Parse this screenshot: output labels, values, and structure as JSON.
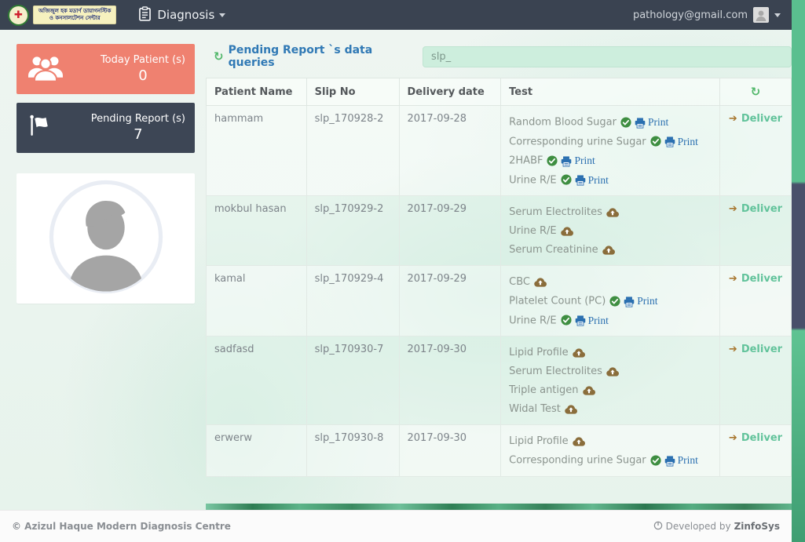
{
  "navbar": {
    "logo_glyph": "✚",
    "brand_line1": "অজিজুল হক মডার্ণ ডায়াগনস্টিক",
    "brand_line2": "ও কনসালটেশন সেন্টার",
    "menu_label": "Diagnosis",
    "user_email": "pathology@gmail.com"
  },
  "sidebar": {
    "cards": [
      {
        "icon": "users",
        "label": "Today Patient (s)",
        "value": "0",
        "bg": "#ef8170"
      },
      {
        "icon": "flag",
        "label": "Pending Report (s)",
        "value": "7",
        "bg": "#3d4655"
      }
    ]
  },
  "main": {
    "title": "Pending Report `s data queries",
    "search_value": "slp_",
    "table": {
      "headers": [
        "Patient Name",
        "Slip No",
        "Delivery date",
        "Test"
      ],
      "print_label": "Print",
      "deliver_label": "Deliver",
      "rows": [
        {
          "patient": "hammam",
          "slip": "slp_170928-2",
          "date": "2017-09-28",
          "tests": [
            {
              "name": "Random Blood Sugar",
              "printable": true
            },
            {
              "name": "Corresponding urine Sugar",
              "printable": true
            },
            {
              "name": "2HABF",
              "printable": true
            },
            {
              "name": "Urine R/E",
              "printable": true
            }
          ]
        },
        {
          "patient": "mokbul hasan",
          "slip": "slp_170929-2",
          "date": "2017-09-29",
          "tests": [
            {
              "name": "Serum Electrolites",
              "printable": false
            },
            {
              "name": "Urine R/E",
              "printable": false
            },
            {
              "name": "Serum Creatinine",
              "printable": false
            }
          ]
        },
        {
          "patient": "kamal",
          "slip": "slp_170929-4",
          "date": "2017-09-29",
          "tests": [
            {
              "name": "CBC",
              "printable": false
            },
            {
              "name": "Platelet Count (PC)",
              "printable": true
            },
            {
              "name": "Urine R/E",
              "printable": true
            }
          ]
        },
        {
          "patient": "sadfasd",
          "slip": "slp_170930-7",
          "date": "2017-09-30",
          "tests": [
            {
              "name": "Lipid Profile",
              "printable": false
            },
            {
              "name": "Serum Electrolites",
              "printable": false
            },
            {
              "name": "Triple antigen",
              "printable": false
            },
            {
              "name": "Widal Test",
              "printable": false
            }
          ]
        },
        {
          "patient": "erwerw",
          "slip": "slp_170930-8",
          "date": "2017-09-30",
          "tests": [
            {
              "name": "Lipid Profile",
              "printable": false
            },
            {
              "name": "Corresponding urine Sugar",
              "printable": true
            }
          ]
        }
      ]
    }
  },
  "footer": {
    "left": "© Azizul Haque Modern Diagnosis Centre",
    "right_prefix": "Developed by",
    "right_brand": "ZinfoSys"
  },
  "colors": {
    "navbar_bg": "#3a4351",
    "title_blue": "#3079b5",
    "refresh_green": "#53b86c",
    "card_salmon": "#ef8170",
    "card_dark": "#3d4655",
    "check_green": "#3e8e41",
    "print_blue": "#2a6fb0",
    "cloud_brown": "#8a6d3b",
    "deliver_green": "#62c39b",
    "deliver_arrow_brown": "#a8772f"
  }
}
